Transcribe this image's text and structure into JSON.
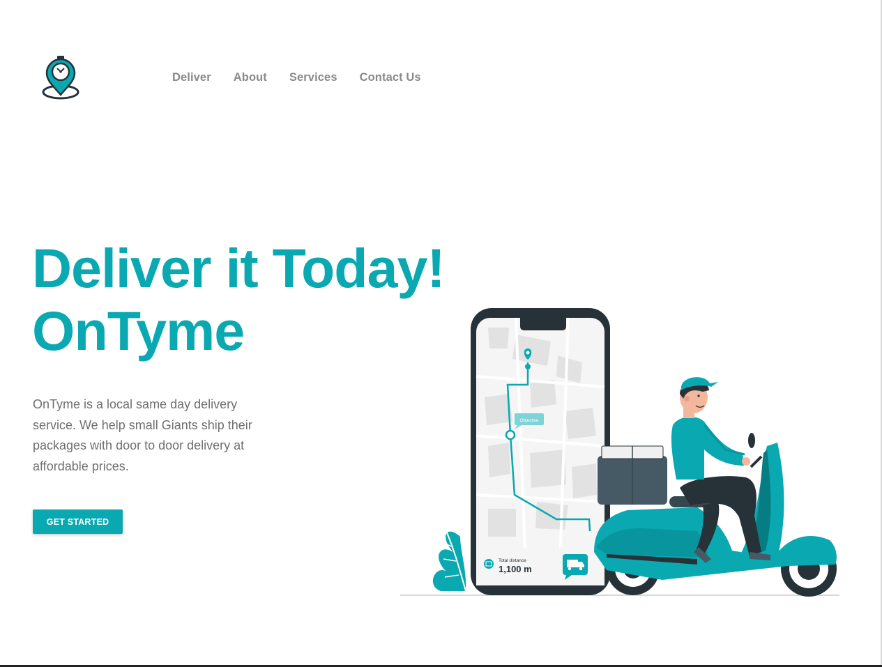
{
  "nav": {
    "items": [
      {
        "label": "Deliver"
      },
      {
        "label": "About"
      },
      {
        "label": "Services"
      },
      {
        "label": "Contact Us"
      }
    ]
  },
  "hero": {
    "title_line1": "Deliver it Today!",
    "title_line2": "OnTyme",
    "description": "OnTyme is a local same day delivery service. We help small Giants ship their packages with door to door delivery at affordable prices.",
    "cta_label": "GET STARTED"
  },
  "illustration": {
    "map_tag": "Objective",
    "distance_label": "Total distance",
    "distance_value": "1,100 m"
  },
  "colors": {
    "accent": "#0aa8b1",
    "nav_text": "#8a8a8a",
    "body_text": "#6f6f6f",
    "dark": "#263238"
  }
}
